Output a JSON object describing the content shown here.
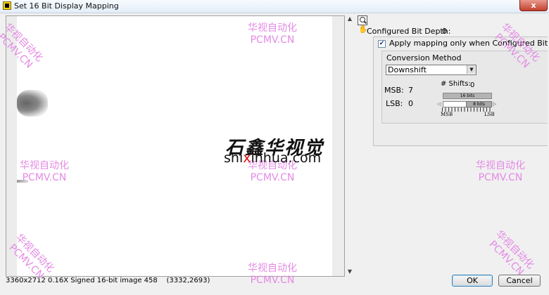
{
  "window": {
    "title": "Set 16 Bit Display Mapping",
    "close_label": "x"
  },
  "image": {
    "status": "3360x2712 0.16X Signed 16-bit image 458    (3332,2693)"
  },
  "settings": {
    "configured_bit_depth_label": "Configured Bit Depth:",
    "configured_bit_depth_value": "0",
    "apply_checked": true,
    "apply_label": "Apply mapping only when Configured Bit Depth",
    "conversion_method_label": "Conversion Method",
    "conversion_method_value": "Downshift",
    "shifts_label": "# Shifts:",
    "shifts_value": "0",
    "msb_label": "MSB:",
    "msb_value": "7",
    "lsb_label": "LSB:",
    "lsb_value": "0",
    "bits16_label": "16 bits",
    "bits8_label": "8 bits",
    "scale_msb": "MSB",
    "scale_lsb": "LSB"
  },
  "buttons": {
    "ok": "OK",
    "cancel": "Cancel"
  },
  "watermark": {
    "chinese": "华视自动化",
    "latin": "PCMV.CN",
    "logo_script": "石鑫华视觉",
    "logo_domain_pre": "shi",
    "logo_domain_x": "x",
    "logo_domain_post": "inhua.com"
  },
  "colors": {
    "watermark": "#e48ae4",
    "logo_x": "#e01010"
  }
}
